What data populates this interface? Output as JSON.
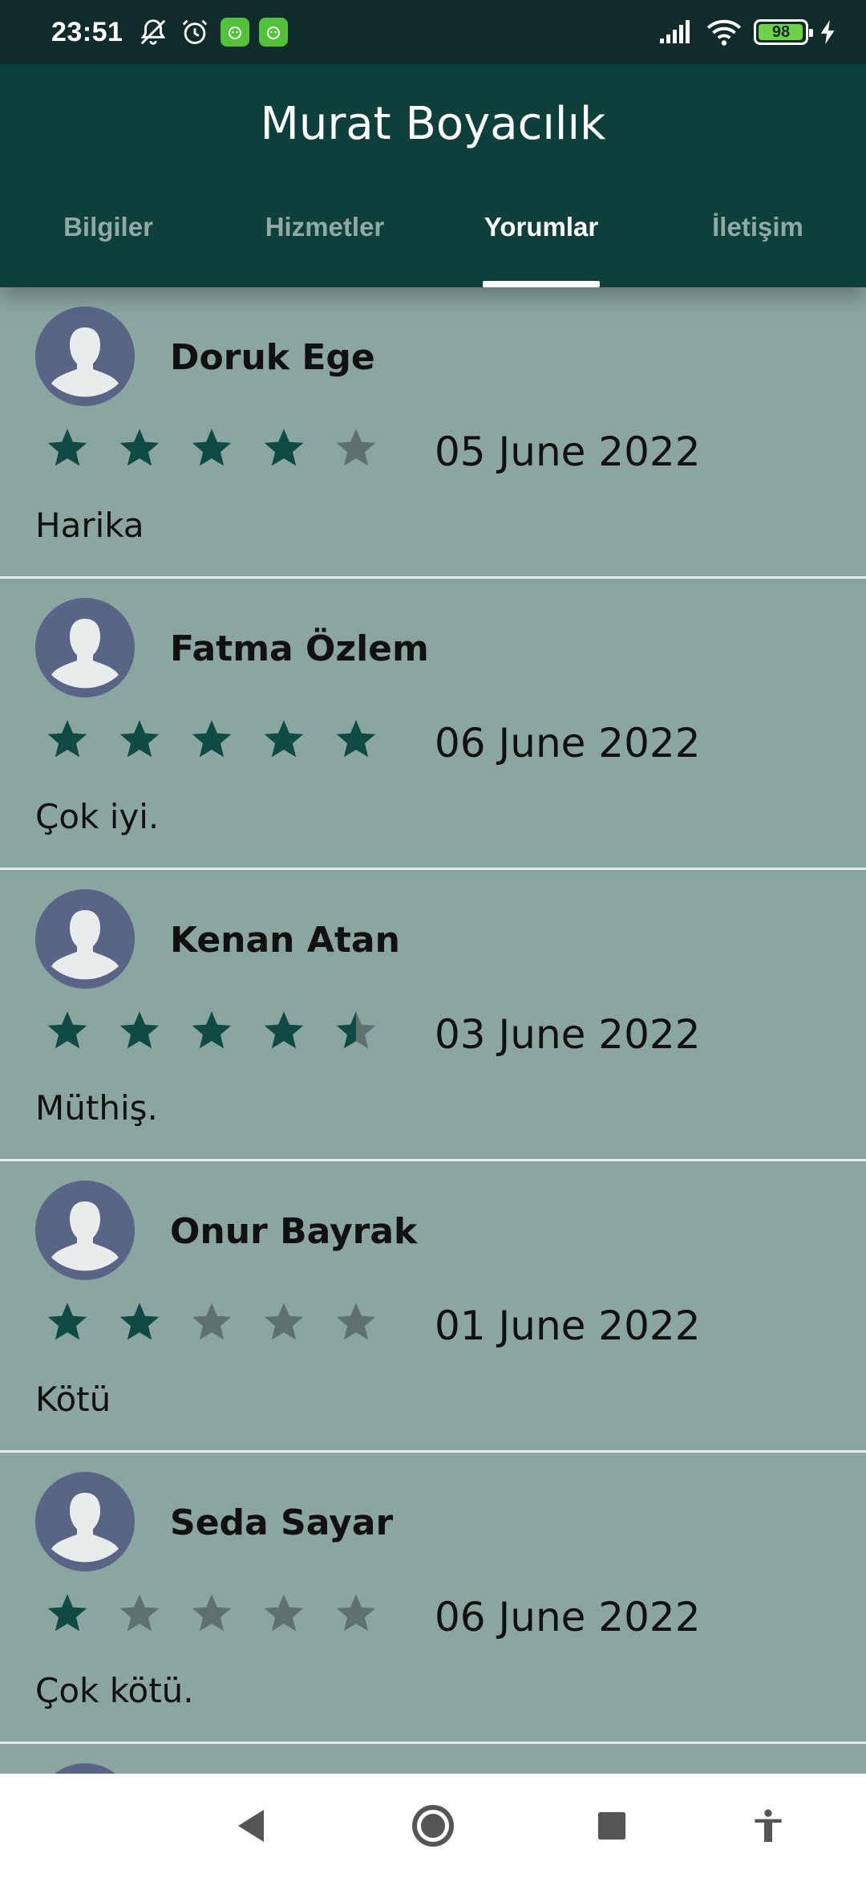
{
  "status_bar": {
    "time": "23:51",
    "battery_level": "98",
    "icons_left": [
      "mute-icon",
      "alarm-icon",
      "app-notification-icon",
      "app-notification-icon"
    ],
    "icons_right": [
      "signal-icon",
      "wifi-icon",
      "battery-icon",
      "charging-icon"
    ]
  },
  "header": {
    "title": "Murat Boyacılık",
    "tabs": [
      {
        "label": "Bilgiler",
        "active": false
      },
      {
        "label": "Hizmetler",
        "active": false
      },
      {
        "label": "Yorumlar",
        "active": true
      },
      {
        "label": "İletişim",
        "active": false
      }
    ]
  },
  "colors": {
    "header_bg": "#0f3f3b",
    "list_bg": "#8ba6a1",
    "star_filled": "#0f4a43",
    "star_empty": "#5f716e",
    "avatar_bg": "#5a6487"
  },
  "reviews": [
    {
      "name": "Doruk Ege",
      "rating": 4,
      "date": "05 June 2022",
      "comment": "Harika"
    },
    {
      "name": "Fatma Özlem",
      "rating": 5,
      "date": "06 June 2022",
      "comment": "Çok iyi."
    },
    {
      "name": "Kenan Atan",
      "rating": 4.5,
      "date": "03 June 2022",
      "comment": "Müthiş."
    },
    {
      "name": "Onur Bayrak",
      "rating": 2,
      "date": "01 June 2022",
      "comment": "Kötü"
    },
    {
      "name": "Seda Sayar",
      "rating": 1,
      "date": "06 June 2022",
      "comment": "Çok kötü."
    }
  ],
  "nav": [
    "back-icon",
    "home-icon",
    "recents-icon",
    "accessibility-icon"
  ]
}
